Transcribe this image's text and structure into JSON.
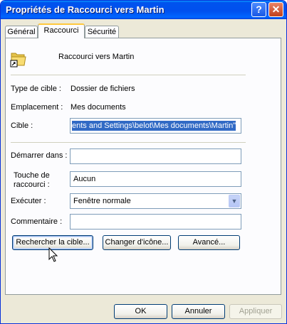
{
  "window": {
    "title": "Propriétés de Raccourci vers Martin",
    "help_glyph": "?",
    "close_glyph": "✕"
  },
  "tabs": [
    {
      "label": "Général"
    },
    {
      "label": "Raccourci",
      "active": true
    },
    {
      "label": "Sécurité"
    }
  ],
  "header": {
    "name": "Raccourci vers Martin",
    "icon": "folder-shortcut-icon"
  },
  "info": {
    "type_label": "Type de cible :",
    "type_value": "Dossier de fichiers",
    "location_label": "Emplacement :",
    "location_value": "Mes documents"
  },
  "fields": {
    "target_label": "Cible :",
    "target_value": "ents and Settings\\belot\\Mes documents\\Martin\"",
    "startin_label": "Démarrer dans :",
    "startin_value": "",
    "shortcut_label_1": "Touche de",
    "shortcut_label_2": "raccourci :",
    "shortcut_value": "Aucun",
    "run_label": "Exécuter :",
    "run_value": "Fenêtre normale",
    "comment_label": "Commentaire :",
    "comment_value": ""
  },
  "buttons": {
    "find_target": "Rechercher la cible...",
    "change_icon": "Changer d'icône...",
    "advanced": "Avancé...",
    "ok": "OK",
    "cancel": "Annuler",
    "apply": "Appliquer"
  },
  "colors": {
    "titlebar": "#0053ee",
    "dialog_bg": "#ece9d8",
    "selection": "#316ac5",
    "tab_highlight": "#ffc83c"
  }
}
